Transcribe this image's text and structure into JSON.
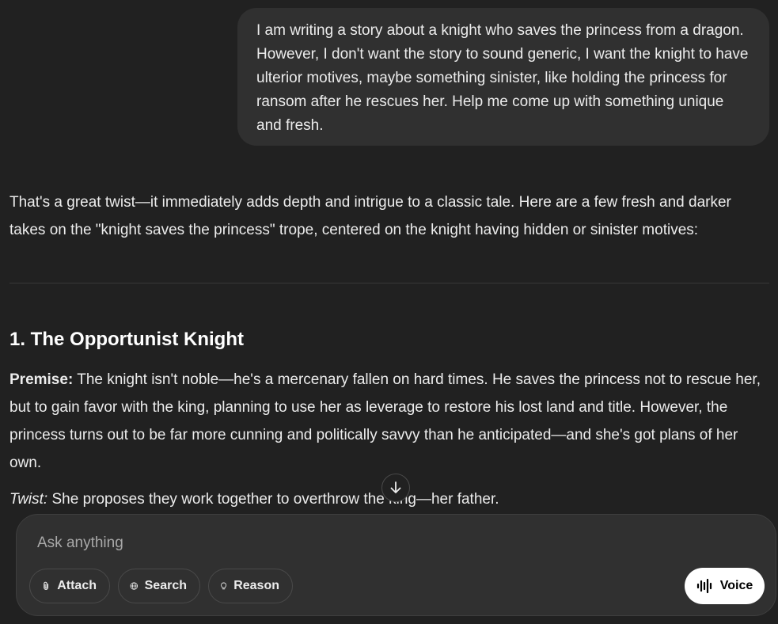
{
  "user_message": "I am writing a story about a knight who saves the princess from a dragon. However, I don't want the story to sound generic, I want the knight to have ulterior motives, maybe something sinister, like holding the princess for ransom after he rescues her. Help me come up with something unique and fresh.",
  "assistant": {
    "intro": "That's a great twist—it immediately adds depth and intrigue to a classic tale. Here are a few fresh and darker takes on the \"knight saves the princess\" trope, centered on the knight having hidden or sinister motives:",
    "section1": {
      "heading": "1. The Opportunist Knight",
      "premise_label": "Premise:",
      "premise_text": " The knight isn't noble—he's a mercenary fallen on hard times. He saves the princess not to rescue her, but to gain favor with the king, planning to use her as leverage to restore his lost land and title. However, the princess turns out to be far more cunning and politically savvy than he anticipated—and she's got plans of her own.",
      "twist_label": "Twist:",
      "twist_text": " She proposes they work together to overthrow the king—her father."
    }
  },
  "composer": {
    "placeholder": "Ask anything",
    "attach_label": "Attach",
    "search_label": "Search",
    "reason_label": "Reason",
    "voice_label": "Voice"
  },
  "icons": {
    "scroll": "arrow-down-icon",
    "attach": "paperclip-icon",
    "search": "globe-icon",
    "reason": "lightbulb-icon",
    "voice": "waveform-icon"
  },
  "colors": {
    "background": "#212121",
    "bubble": "#303030",
    "text": "#ececec",
    "voice_bg": "#ffffff"
  }
}
